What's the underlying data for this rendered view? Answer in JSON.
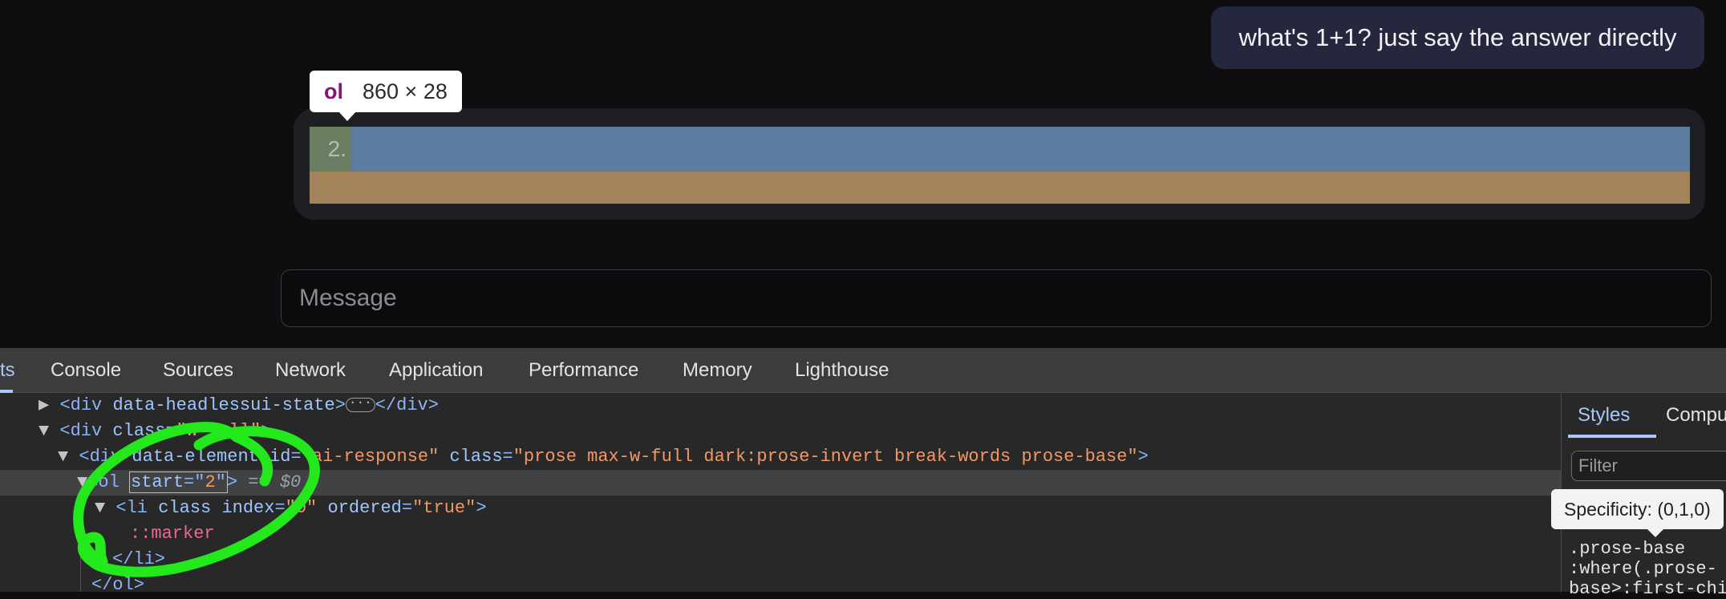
{
  "chat": {
    "user_message": "what's 1+1? just say the answer directly",
    "inspect_tooltip": {
      "tag": "ol",
      "dimensions": "860 × 28"
    },
    "list_marker": "2.",
    "message_placeholder": "Message"
  },
  "devtools": {
    "tabs": {
      "elements_partial": "ts",
      "console": "Console",
      "sources": "Sources",
      "network": "Network",
      "application": "Application",
      "performance": "Performance",
      "memory": "Memory",
      "lighthouse": "Lighthouse"
    },
    "dom": {
      "line1": {
        "tag": "div",
        "attr": "data-headlessui-state",
        "close": "</div>"
      },
      "line2": {
        "tag": "div",
        "attr": "class",
        "value": "\"w-full\""
      },
      "line3": {
        "tag": "div",
        "attr1": "data-element-id",
        "value1": "\"ai-response\"",
        "attr2": "class",
        "value2": "\"prose max-w-full dark:prose-invert break-words prose-base\""
      },
      "line4": {
        "tag": "ol",
        "attr": "start",
        "value": "2",
        "eq": "== $0"
      },
      "line5": {
        "tag": "li",
        "attr1": "class",
        "attr2": "index",
        "value2": "\"0\"",
        "attr3": "ordered",
        "value3": "\"true\""
      },
      "line6": {
        "pseudo": "::marker"
      },
      "line7": {
        "close": "</li>"
      },
      "line8": {
        "close": "</ol>"
      }
    },
    "styles_pane": {
      "tab_styles": "Styles",
      "tab_computed": "Compu",
      "filter_placeholder": "Filter",
      "specificity_tooltip": "Specificity: (0,1,0)",
      "css_selector_lines": [
        ".prose-base",
        ":where(.prose-",
        "base>:first-chi"
      ]
    }
  },
  "colors": {
    "annotation_stroke": "#22e81c",
    "content_highlight": "#5e7c9f",
    "margin_highlight": "#a4835b"
  }
}
